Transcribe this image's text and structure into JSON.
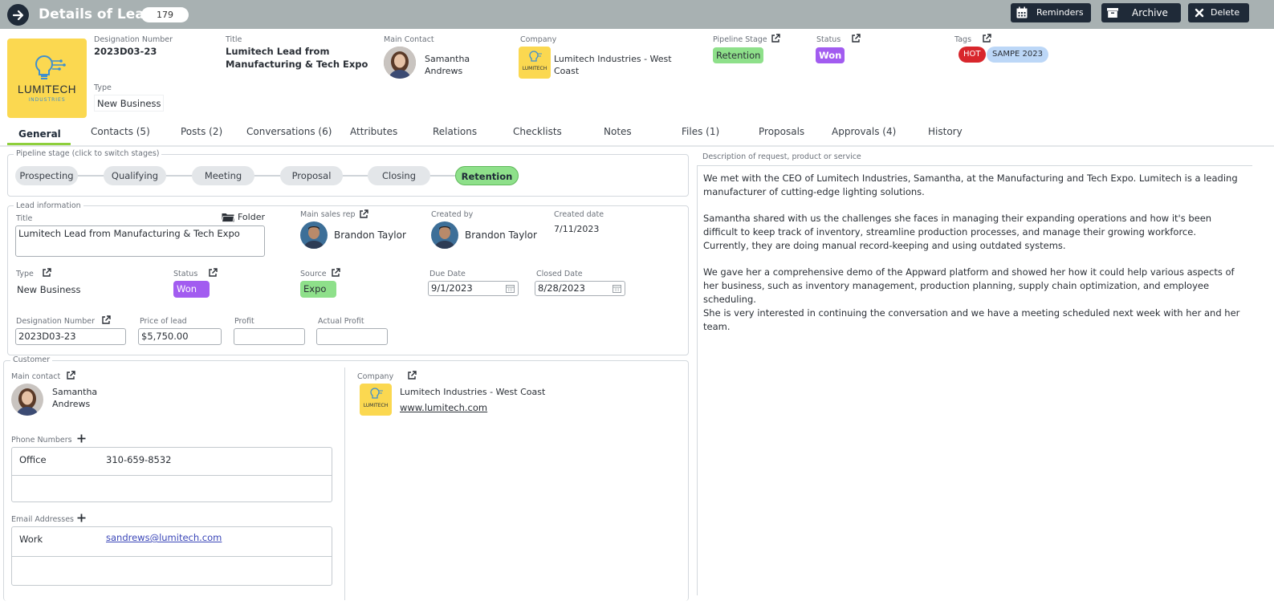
{
  "header": {
    "title": "Details of Lead",
    "count": "179",
    "reminders_label": "Reminders",
    "archive_label": "Archive",
    "delete_label": "Delete"
  },
  "summary": {
    "designation_label": "Designation Number",
    "designation_value": "2023D03-23",
    "title_label": "Title",
    "title_line1": "Lumitech Lead from",
    "title_line2": "Manufacturing & Tech Expo",
    "main_contact_label": "Main Contact",
    "main_contact_first": "Samantha",
    "main_contact_last": "Andrews",
    "company_label": "Company",
    "company_line1": "Lumitech Industries - West",
    "company_line2": "Coast",
    "pipeline_label": "Pipeline Stage",
    "pipeline_value": "Retention",
    "status_label": "Status",
    "status_value": "Won",
    "tags_label": "Tags",
    "tags": [
      "HOT",
      "SAMPE 2023"
    ],
    "type_label": "Type",
    "type_value": "New Business",
    "logo_text": "LUMITECH",
    "logo_sub": "INDUSTRIES",
    "small_logo_text": "LUMITECH"
  },
  "tabs": [
    {
      "label": "General"
    },
    {
      "label": "Contacts (5)"
    },
    {
      "label": "Posts (2)"
    },
    {
      "label": "Conversations (6)"
    },
    {
      "label": "Attributes"
    },
    {
      "label": "Relations"
    },
    {
      "label": "Checklists"
    },
    {
      "label": "Notes"
    },
    {
      "label": "Files (1)"
    },
    {
      "label": "Proposals"
    },
    {
      "label": "Approvals (4)"
    },
    {
      "label": "History"
    }
  ],
  "pipeline": {
    "legend": "Pipeline stage (click to switch stages)",
    "stages": [
      {
        "label": "Prospecting"
      },
      {
        "label": "Qualifying"
      },
      {
        "label": "Meeting"
      },
      {
        "label": "Proposal"
      },
      {
        "label": "Closing"
      },
      {
        "label": "Retention"
      }
    ]
  },
  "lead": {
    "legend": "Lead information",
    "title_label": "Title",
    "folder_label": "Folder",
    "title_value": "Lumitech Lead from Manufacturing & Tech Expo",
    "main_rep_label": "Main sales rep",
    "main_rep_value": "Brandon Taylor",
    "created_by_label": "Created by",
    "created_by_value": "Brandon Taylor",
    "created_date_label": "Created date",
    "created_date_value": "7/11/2023",
    "type_label": "Type",
    "type_value": "New Business",
    "status_label": "Status",
    "status_value": "Won",
    "source_label": "Source",
    "source_value": "Expo",
    "due_label": "Due Date",
    "due_value": "9/1/2023",
    "closed_label": "Closed Date",
    "closed_value": "8/28/2023",
    "designation_label": "Designation Number",
    "designation_value": "2023D03-23",
    "price_label": "Price of lead",
    "price_value": "$5,750.00",
    "profit_label": "Profit",
    "actual_profit_label": "Actual Profit"
  },
  "customer": {
    "legend": "Customer",
    "main_contact_label": "Main contact",
    "contact_first": "Samantha",
    "contact_last": "Andrews",
    "company_label": "Company",
    "company_name": "Lumitech Industries - West Coast",
    "company_url": "www.lumitech.com",
    "phones_label": "Phone Numbers",
    "phone_type": "Office",
    "phone_value": "310-659-8532",
    "emails_label": "Email Addresses",
    "email_type": "Work",
    "email_value": "sandrews@lumitech.com"
  },
  "description": {
    "label": "Description of request, product or service",
    "p1": "We met with the CEO of Lumitech Industries, Samantha, at the Manufacturing and Tech Expo. Lumitech is a leading manufacturer of cutting-edge lighting solutions.",
    "p2": "Samantha shared with us the challenges she faces in managing their expanding operations and how it's been difficult to keep track of inventory, streamline production processes, and manage their growing workforce. Currently, they are doing manual record-keeping and using outdated systems.",
    "p3": "We gave her a comprehensive demo of the Appward platform and showed her how it could help various aspects of her business, such as inventory management, production planning, supply chain optimization, and employee scheduling.",
    "p4": "She is very interested in continuing the conversation and we have a meeting scheduled next week with her and her team."
  },
  "colors": {
    "header_bg": "#a8b1b2",
    "dark_button": "#1f2a38",
    "retention_green": "#8ee08a",
    "won_purple": "#a25cf0",
    "hot_red": "#d8262c",
    "tag_blue": "#bcd7f7",
    "logo_yellow": "#fbd850",
    "tab_underline": "#8ecf3c"
  }
}
